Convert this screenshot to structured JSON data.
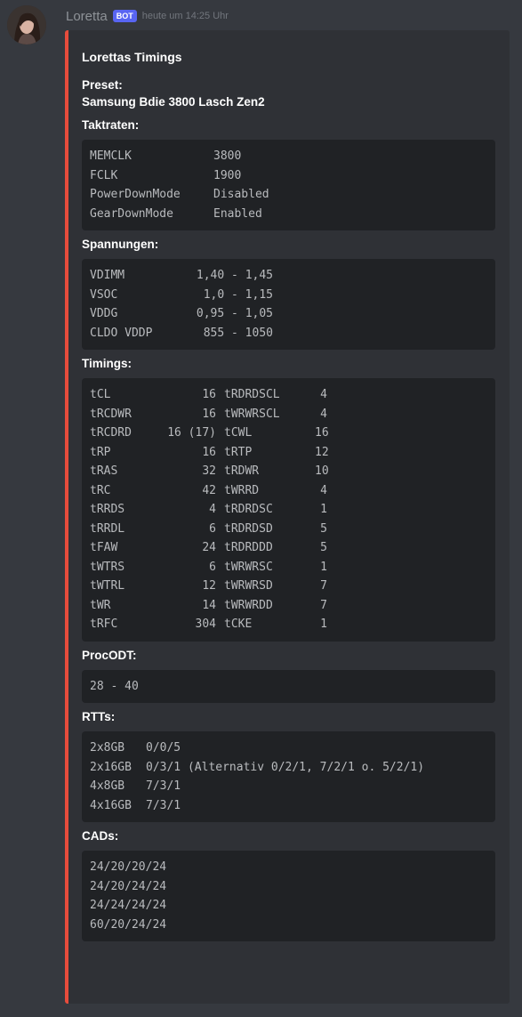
{
  "message": {
    "username": "Loretta",
    "badge": "BOT",
    "timestamp": "heute um 14:25 Uhr"
  },
  "embed": {
    "accent_color": "#e74c3c",
    "title": "Lorettas Timings",
    "preset": {
      "name": "Preset:",
      "value": "Samsung Bdie 3800 Lasch Zen2"
    },
    "taktraten": {
      "name": "Taktraten:",
      "rows": [
        [
          "MEMCLK",
          "3800"
        ],
        [
          "FCLK",
          "1900"
        ],
        [
          "PowerDownMode",
          "Disabled"
        ],
        [
          "GearDownMode",
          "Enabled"
        ]
      ]
    },
    "spannungen": {
      "name": "Spannungen:",
      "rows": [
        [
          "VDIMM",
          "1,40 - 1,45"
        ],
        [
          "VSOC",
          "1,0 - 1,15"
        ],
        [
          "VDDG",
          "0,95 - 1,05"
        ],
        [
          "CLDO VDDP",
          "855 - 1050"
        ]
      ]
    },
    "timings": {
      "name": "Timings:",
      "rows": [
        [
          "tCL",
          "16",
          "tRDRDSCL",
          "4"
        ],
        [
          "tRCDWR",
          "16",
          "tWRWRSCL",
          "4"
        ],
        [
          "tRCDRD",
          "16 (17)",
          "tCWL",
          "16"
        ],
        [
          "tRP",
          "16",
          "tRTP",
          "12"
        ],
        [
          "tRAS",
          "32",
          "tRDWR",
          "10"
        ],
        [
          "tRC",
          "42",
          "tWRRD",
          "4"
        ],
        [
          "tRRDS",
          "4",
          "tRDRDSC",
          "1"
        ],
        [
          "tRRDL",
          "6",
          "tRDRDSD",
          "5"
        ],
        [
          "tFAW",
          "24",
          "tRDRDDD",
          "5"
        ],
        [
          "tWTRS",
          "6",
          "tWRWRSC",
          "1"
        ],
        [
          "tWTRL",
          "12",
          "tWRWRSD",
          "7"
        ],
        [
          "tWR",
          "14",
          "tWRWRDD",
          "7"
        ],
        [
          "tRFC",
          "304",
          "tCKE",
          "1"
        ]
      ]
    },
    "procodt": {
      "name": "ProcODT:",
      "rows": [
        "28 - 40"
      ]
    },
    "rtts": {
      "name": "RTTs:",
      "rows": [
        [
          "2x8GB",
          "0/0/5"
        ],
        [
          "2x16GB",
          "0/3/1 (Alternativ 0/2/1, 7/2/1 o. 5/2/1)"
        ],
        [
          "4x8GB",
          "7/3/1"
        ],
        [
          "4x16GB",
          "7/3/1"
        ]
      ]
    },
    "cads": {
      "name": "CADs:",
      "rows": [
        "24/20/20/24",
        "24/20/24/24",
        "24/24/24/24",
        "60/20/24/24"
      ]
    }
  }
}
